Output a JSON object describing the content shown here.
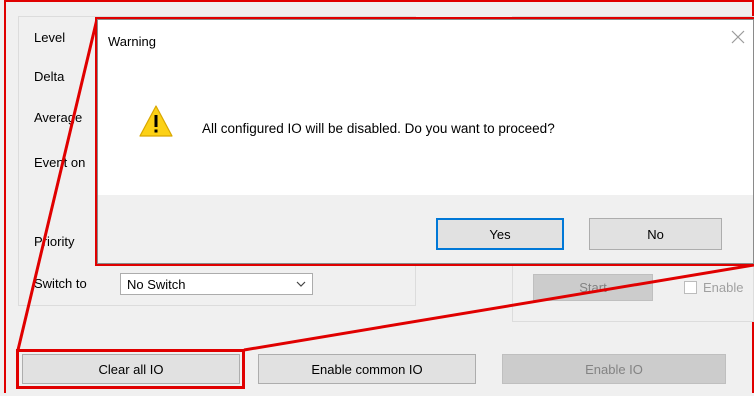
{
  "left_panel": {
    "labels": {
      "level": "Level",
      "delta": "Delta",
      "average": "Average",
      "event": "Event on",
      "priority": "Priority",
      "switch_to": "Switch to"
    },
    "switch_to_value": "No Switch"
  },
  "right_panel": {
    "start_label": "Start",
    "enable_label": "Enable"
  },
  "bottom_buttons": {
    "clear_all": "Clear all IO",
    "enable_common": "Enable common IO",
    "enable_io": "Enable IO"
  },
  "dialog": {
    "title": "Warning",
    "message": "All configured IO will be disabled. Do you want to proceed?",
    "yes": "Yes",
    "no": "No",
    "icon": "warning-icon"
  },
  "colors": {
    "highlight": "#e00000",
    "default_button_border": "#0078d7",
    "warning_yellow": "#fcd116"
  }
}
